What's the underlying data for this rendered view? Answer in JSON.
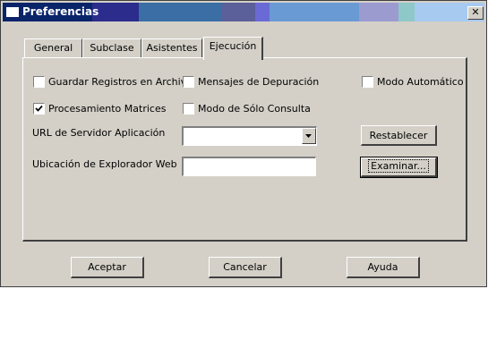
{
  "window": {
    "title": "Preferencias",
    "close_glyph": "✕"
  },
  "tabs": [
    {
      "label": "General"
    },
    {
      "label": "Subclase"
    },
    {
      "label": "Asistentes"
    },
    {
      "label": "Ejecución",
      "active": true
    }
  ],
  "options": {
    "guardar_registros": {
      "label": "Guardar Registros en Archivo",
      "checked": false
    },
    "mensajes_depuracion": {
      "label": "Mensajes de Depuración",
      "checked": false
    },
    "modo_automatico": {
      "label": "Modo Automático",
      "checked": false
    },
    "procesamiento_matrices": {
      "label": "Procesamiento Matrices",
      "checked": true
    },
    "modo_solo_consulta": {
      "label": "Modo de Sólo Consulta",
      "checked": false
    }
  },
  "fields": {
    "url_servidor": {
      "label": "URL de Servidor Aplicación",
      "value": ""
    },
    "ubicacion_explorador": {
      "label": "Ubicación de Explorador Web",
      "value": ""
    }
  },
  "buttons": {
    "restablecer": "Restablecer",
    "examinar": "Examinar...",
    "aceptar": "Aceptar",
    "cancelar": "Cancelar",
    "ayuda": "Ayuda"
  },
  "colors": {
    "dialog_bg": "#d4d0c8",
    "title_bar": "#0a246a"
  }
}
